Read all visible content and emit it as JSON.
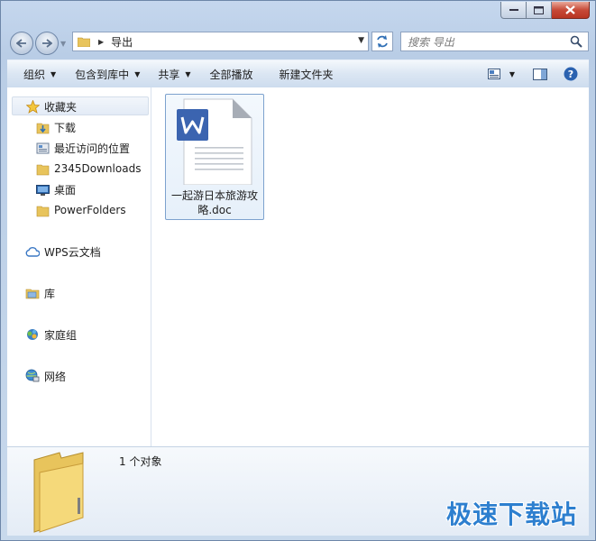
{
  "address": {
    "path": "导出"
  },
  "search": {
    "placeholder": "搜索 导出"
  },
  "toolbar": {
    "organize": "组织",
    "include_in_library": "包含到库中",
    "share": "共享",
    "play_all": "全部播放",
    "new_folder": "新建文件夹"
  },
  "nav": {
    "favorites": "收藏夹",
    "downloads": "下载",
    "recent_places": "最近访问的位置",
    "downloads2345": "2345Downloads",
    "desktop": "桌面",
    "powerfolders": "PowerFolders",
    "wps_cloud": "WPS云文档",
    "libraries": "库",
    "homegroup": "家庭组",
    "network": "网络"
  },
  "file": {
    "name_line1": "一起游日本旅游攻",
    "name_line2": "略.doc"
  },
  "details": {
    "count": "1 个对象"
  },
  "watermark": "极速下载站",
  "colors": {
    "accent": "#3c6bb6",
    "selection": "#e6f0fa",
    "wps_blue": "#3b64b0"
  }
}
